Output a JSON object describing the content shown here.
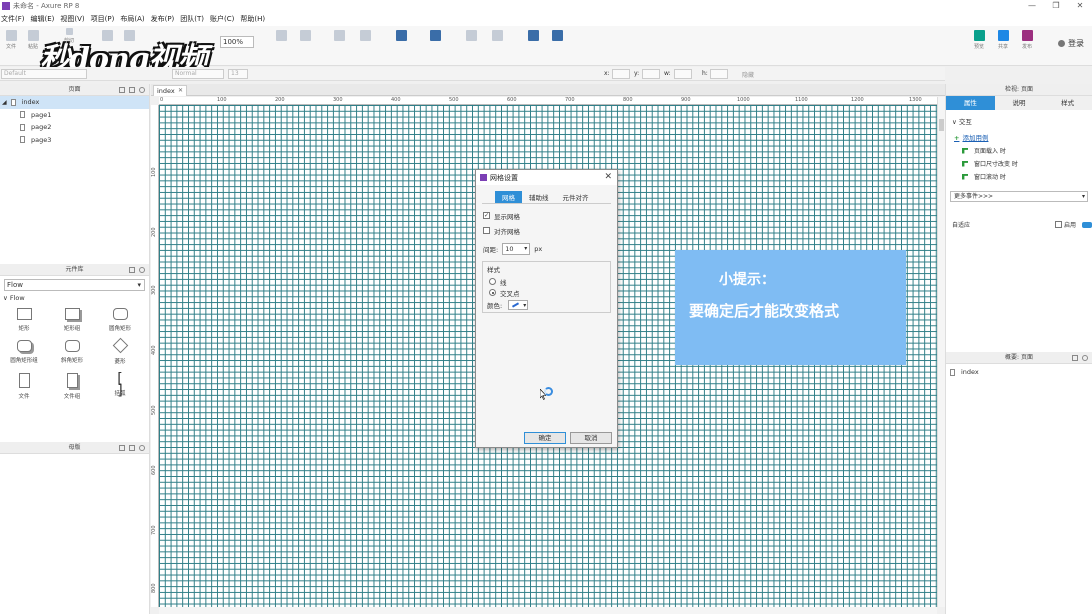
{
  "window": {
    "title": "未命名 - Axure RP 8",
    "controls": [
      "—",
      "❐",
      "✕"
    ]
  },
  "menu": [
    "文件(F)",
    "编辑(E)",
    "视图(V)",
    "项目(P)",
    "布局(A)",
    "发布(P)",
    "团队(T)",
    "账户(C)",
    "帮助(H)"
  ],
  "toolbar": {
    "zoom": "100%",
    "login": "登录",
    "left_labels": [
      "文件",
      "粘贴"
    ],
    "cut_label": "剪切",
    "right_items": [
      "预览",
      "共享",
      "发布"
    ]
  },
  "watermark": "秒dong视频",
  "formatbar": {
    "style": "Default",
    "font_style": "Normal",
    "font_size": "13",
    "x_label": "x:",
    "y_label": "y:",
    "w_label": "w:",
    "h_label": "h:",
    "hidden_label": "隐藏"
  },
  "pages_panel": {
    "title": "页面",
    "items": [
      {
        "label": "index",
        "active": true
      },
      {
        "label": "page1"
      },
      {
        "label": "page2"
      },
      {
        "label": "page3"
      }
    ]
  },
  "library_panel": {
    "title": "元件库",
    "selected": "Flow",
    "group": "Flow",
    "widgets": [
      "矩形",
      "矩形组",
      "圆角矩形",
      "圆角矩形组",
      "斜角矩形",
      "菱形",
      "文件",
      "文件组",
      "括弧"
    ]
  },
  "masters_panel": {
    "title": "母版"
  },
  "canvas": {
    "tab": "index",
    "ruler_h": [
      "0",
      "100",
      "200",
      "300",
      "400",
      "500",
      "600",
      "700",
      "800",
      "900",
      "1000",
      "1100",
      "1200",
      "1300"
    ],
    "ruler_v": [
      "100",
      "200",
      "300",
      "400",
      "500",
      "600",
      "700",
      "800"
    ]
  },
  "dialog": {
    "title": "网格设置",
    "tabs": [
      "网格",
      "辅助线",
      "元件对齐"
    ],
    "show_grid": "显示网格",
    "snap_grid": "对齐网格",
    "spacing_label": "间距:",
    "spacing_value": "10",
    "spacing_unit": "px",
    "style_title": "样式",
    "style_line": "线",
    "style_intersection": "交叉点",
    "color_label": "颜色:",
    "ok": "确定",
    "cancel": "取消"
  },
  "tip": {
    "title": "小提示：",
    "body": "要确定后才能改变格式"
  },
  "inspector": {
    "title": "检视: 页面",
    "tabs": [
      "属性",
      "说明",
      "样式"
    ],
    "interaction": "交互",
    "add_case": "添加用例",
    "events": [
      "页面载入 时",
      "窗口尺寸改变 时",
      "窗口滚动 时"
    ],
    "more_events": "更多事件>>>",
    "adaptive": "自适应",
    "enable": "启用"
  },
  "outline": {
    "title": "概要: 页面",
    "item": "index"
  }
}
